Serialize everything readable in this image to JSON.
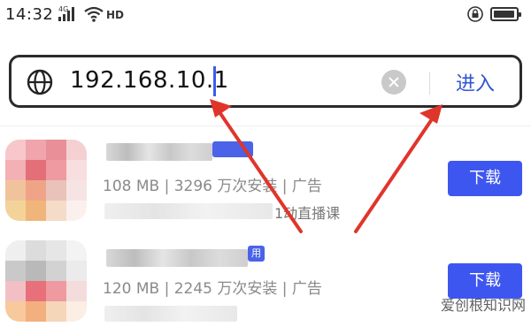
{
  "status_bar": {
    "time": "14:32",
    "network_type": "4G",
    "hd_label": "HD"
  },
  "address_bar": {
    "url_value": "192.168.10.1",
    "enter_label": "进入"
  },
  "apps": [
    {
      "meta": "108 MB | 3296 万次安装 | 广告",
      "desc_fragment": "1动直播课",
      "download_label": "下载"
    },
    {
      "meta": "120 MB | 2245 万次安装 | 广告",
      "tag_fragment": "用",
      "download_label": "下载"
    }
  ],
  "watermark": "爱创根知识网",
  "colors": {
    "accent": "#3e56f0",
    "arrow": "#e0352b"
  }
}
